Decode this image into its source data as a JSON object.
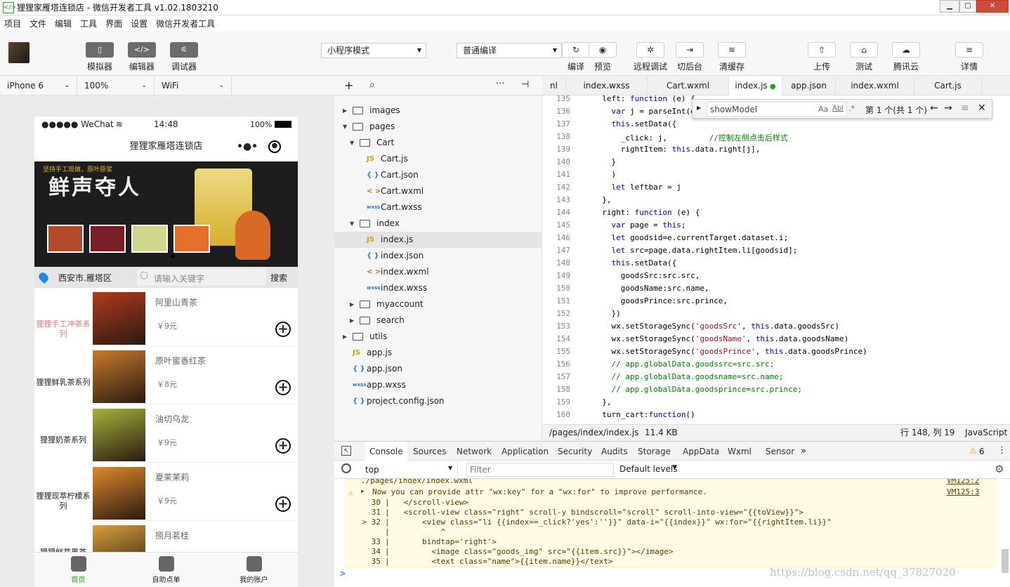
{
  "window": {
    "title": "狸狸家雁塔连锁店 - 微信开发者工具 v1.02.1803210"
  },
  "menubar": [
    "项目",
    "文件",
    "编辑",
    "工具",
    "界面",
    "设置",
    "微信开发者工具"
  ],
  "toolbar": {
    "left_buttons": [
      {
        "label": "模拟器",
        "icon": "phone-icon",
        "glyph": "▯"
      },
      {
        "label": "编辑器",
        "icon": "code-icon",
        "glyph": "</>"
      },
      {
        "label": "调试器",
        "icon": "debug-icon",
        "glyph": "⚟"
      }
    ],
    "mode_select": "小程序模式",
    "compile_select": "普通编译",
    "right_buttons": [
      {
        "label": "编译",
        "icon": "refresh-icon",
        "glyph": "↻"
      },
      {
        "label": "预览",
        "icon": "eye-icon",
        "glyph": "◉"
      },
      {
        "label": "远程调试",
        "icon": "bug-icon",
        "glyph": "✲"
      },
      {
        "label": "切后台",
        "icon": "switch-icon",
        "glyph": "⇥"
      },
      {
        "label": "清缓存",
        "icon": "layers-icon",
        "glyph": "≋"
      },
      {
        "label": "上传",
        "icon": "upload-icon",
        "glyph": "⇧"
      },
      {
        "label": "测试",
        "icon": "flask-icon",
        "glyph": "⌂"
      },
      {
        "label": "腾讯云",
        "icon": "cloud-icon",
        "glyph": "☁"
      },
      {
        "label": "详情",
        "icon": "menu-icon",
        "glyph": "≡"
      }
    ]
  },
  "device_bar": {
    "device": "iPhone 6",
    "zoom": "100%",
    "network": "WiFi"
  },
  "phone": {
    "status": {
      "carrier": "●●●●● WeChat",
      "time": "14:48",
      "battery": "100%"
    },
    "nav_title": "狸狸家雁塔连锁店",
    "banner": {
      "headline": "鲜声夺人",
      "tagline": "坚持手工现做，原叶原浆"
    },
    "location": "西安市.雁塔区",
    "search_placeholder": "请输入关键字",
    "search_button": "搜索",
    "categories": [
      "狸狸手工冲茶系列",
      "狸狸鲜乳茶系列",
      "狸狸奶茶系列",
      "狸狸现萃柠檬系列",
      "狸狸鲜萃果茶"
    ],
    "goods": [
      {
        "name": "阿里山青茶",
        "price": "￥9元",
        "color": "#b23a1c"
      },
      {
        "name": "原叶蜜香红茶",
        "price": "￥8元",
        "color": "#c97a2a"
      },
      {
        "name": "油切乌龙",
        "price": "￥9元",
        "color": "#a6b33a"
      },
      {
        "name": "夏茉茉莉",
        "price": "￥9元",
        "color": "#e0892a"
      },
      {
        "name": "捌月茗桂",
        "price": "",
        "color": "#d9a13c"
      }
    ],
    "tabs": [
      "首页",
      "自助点单",
      "我的账户"
    ]
  },
  "file_tree": [
    {
      "type": "folder",
      "name": "images",
      "depth": 0,
      "open": false
    },
    {
      "type": "folder",
      "name": "pages",
      "depth": 0,
      "open": true
    },
    {
      "type": "folder",
      "name": "Cart",
      "depth": 1,
      "open": true
    },
    {
      "type": "js",
      "name": "Cart.js",
      "depth": 2
    },
    {
      "type": "json",
      "name": "Cart.json",
      "depth": 2
    },
    {
      "type": "wxml",
      "name": "Cart.wxml",
      "depth": 2
    },
    {
      "type": "wxss",
      "name": "Cart.wxss",
      "depth": 2
    },
    {
      "type": "folder",
      "name": "index",
      "depth": 1,
      "open": true
    },
    {
      "type": "js",
      "name": "index.js",
      "depth": 2,
      "selected": true
    },
    {
      "type": "json",
      "name": "index.json",
      "depth": 2
    },
    {
      "type": "wxml",
      "name": "index.wxml",
      "depth": 2
    },
    {
      "type": "wxss",
      "name": "index.wxss",
      "depth": 2
    },
    {
      "type": "folder",
      "name": "myaccount",
      "depth": 1,
      "open": false
    },
    {
      "type": "folder",
      "name": "search",
      "depth": 1,
      "open": false
    },
    {
      "type": "folder",
      "name": "utils",
      "depth": 0,
      "open": false
    },
    {
      "type": "js",
      "name": "app.js",
      "depth": 0
    },
    {
      "type": "json",
      "name": "app.json",
      "depth": 0
    },
    {
      "type": "wxss",
      "name": "app.wxss",
      "depth": 0
    },
    {
      "type": "json",
      "name": "project.config.json",
      "depth": 0
    }
  ],
  "file_icons": {
    "js": "JS",
    "json": "{ }",
    "wxml": "< >",
    "wxss": "wxss"
  },
  "editor": {
    "tabs": [
      "nl",
      "index.wxss",
      "Cart.wxml",
      "index.js",
      "app.json",
      "index.wxml",
      "Cart.js"
    ],
    "active_tab": 3,
    "find_text": "showModel",
    "find_count": "第 1 个(共 1 个)",
    "find_opts": [
      "Aa",
      "Abl",
      ".*"
    ],
    "lines": [
      {
        "n": 135,
        "t": "  left: function (e) {"
      },
      {
        "n": 136,
        "t": "    var j = parseInt(e.c"
      },
      {
        "n": 137,
        "t": "    this.setData({"
      },
      {
        "n": 138,
        "t": "      _click: j,         //控制左侧点击后样式"
      },
      {
        "n": 139,
        "t": "      rightItem: this.data.right[j],"
      },
      {
        "n": 140,
        "t": "    }"
      },
      {
        "n": 141,
        "t": "    )"
      },
      {
        "n": 142,
        "t": "    let leftbar = j"
      },
      {
        "n": 143,
        "t": "  },"
      },
      {
        "n": 144,
        "t": "  right: function (e) {"
      },
      {
        "n": 145,
        "t": "    var page = this;"
      },
      {
        "n": 146,
        "t": "    let goodsid=e.currentTarget.dataset.i;"
      },
      {
        "n": 147,
        "t": "    let src=page.data.rightItem.li[goodsid];"
      },
      {
        "n": 148,
        "t": "    this.setData({"
      },
      {
        "n": 149,
        "t": "      goodsSrc:src.src,"
      },
      {
        "n": 150,
        "t": "      goodsName:src.name,"
      },
      {
        "n": 151,
        "t": "      goodsPrince:src.prince,"
      },
      {
        "n": 152,
        "t": "    })"
      },
      {
        "n": 153,
        "t": "    wx.setStorageSync('goodsSrc', this.data.goodsSrc)"
      },
      {
        "n": 154,
        "t": "    wx.setStorageSync('goodsName', this.data.goodsName)"
      },
      {
        "n": 155,
        "t": "    wx.setStorageSync('goodsPrince', this.data.goodsPrince)"
      },
      {
        "n": 156,
        "t": "    // app.globalData.goodssrc=src.src;"
      },
      {
        "n": 157,
        "t": "    // app.globalData.goodsname=src.name;"
      },
      {
        "n": 158,
        "t": "    // app.globalData.goodsprince=src.prince;"
      },
      {
        "n": 159,
        "t": "  },"
      },
      {
        "n": 160,
        "t": "  turn_cart:function()"
      }
    ],
    "status": {
      "path": "/pages/index/index.js",
      "size": "11.4 KB",
      "cursor": "行 148, 列 19",
      "lang": "JavaScript"
    }
  },
  "devtools": {
    "tabs": [
      "Console",
      "Sources",
      "Network",
      "Application",
      "Security",
      "Audits",
      "Storage",
      "AppData",
      "Wxml",
      "Sensor"
    ],
    "warn_count": "6",
    "context": "top",
    "filter_placeholder": "Filter",
    "levels": "Default levels",
    "prev_src": "./pages/index/index.wxml",
    "prev_ref": "VM125:2",
    "warning": "Now you can provide attr \"wx:key\" for a \"wx:for\" to improve performance.",
    "warning_ref": "VM125:3",
    "snippet": [
      {
        "n": "30",
        "t": "|   </scroll-view>"
      },
      {
        "n": "31",
        "t": "|   <scroll-view class=\"right\" scroll-y bindscroll=\"scroll\" scroll-into-view=\"{{toView}}\">"
      },
      {
        "n": "> 32",
        "t": "|       <view class=\"li {{index==_click?'yes':''}}\" data-i=\"{{index}}\" wx:for=\"{{rightItem.li}}\""
      },
      {
        "n": "",
        "t": "|           ^"
      },
      {
        "n": "33",
        "t": "|       bindtap='right'>"
      },
      {
        "n": "34",
        "t": "|         <image class=\"goods_img\" src=\"{{item.src}}\"></image>"
      },
      {
        "n": "35",
        "t": "|         <text class=\"name\">{{item.name}}</text>"
      }
    ],
    "prompt": ">"
  },
  "watermark": "https://blog.csdn.net/qq_37827020"
}
